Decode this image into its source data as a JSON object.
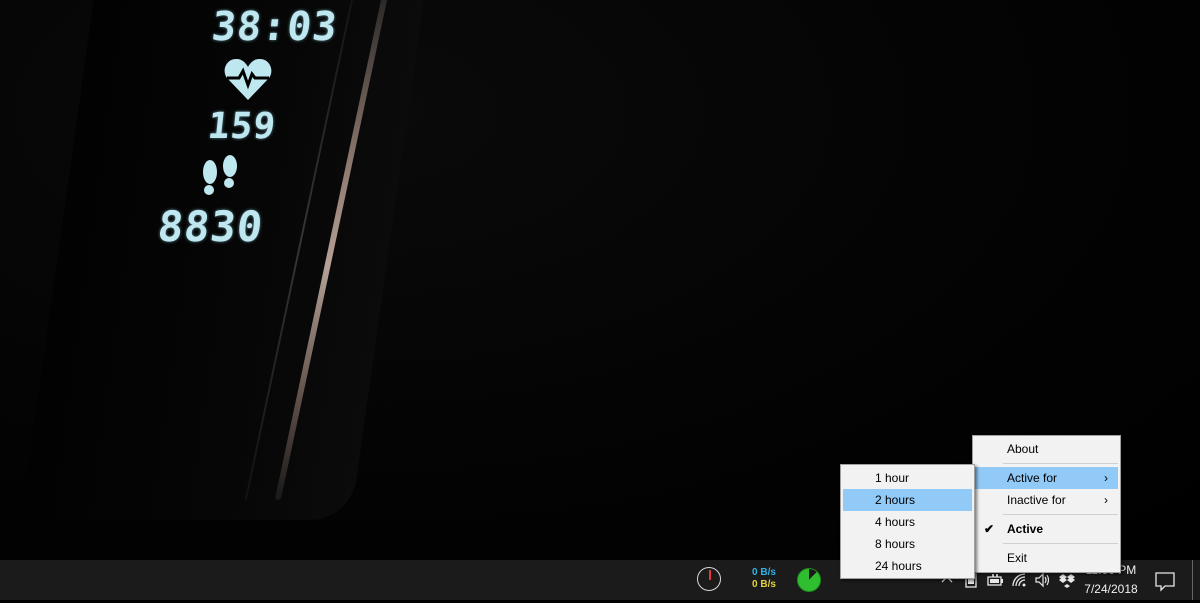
{
  "wallpaper": {
    "watch_time": "38:03",
    "watch_heart_rate": "159",
    "watch_steps": "8830"
  },
  "taskbar": {
    "net_upload": "0 B/s",
    "net_download": "0 B/s",
    "tray_icons": [
      "chevron-up-icon",
      "tablet-icon",
      "battery-icon",
      "wifi-icon",
      "volume-icon",
      "dropbox-icon"
    ],
    "clock_time": "11:00 PM",
    "clock_date": "7/24/2018",
    "colors": {
      "upload": "#2fb2e8",
      "download": "#e6d23a",
      "ram_meter": "#2fbe2f",
      "cpu_needle": "#e23a3a"
    }
  },
  "context_menu": {
    "items": [
      {
        "label": "About"
      },
      {
        "label": "Active for",
        "submenu": true,
        "highlighted": true
      },
      {
        "label": "Inactive for",
        "submenu": true
      },
      {
        "label": "Active",
        "checked": true,
        "bold": true
      },
      {
        "label": "Exit"
      }
    ],
    "highlight_color": "#91c9f7"
  },
  "submenu": {
    "items": [
      {
        "label": "1 hour"
      },
      {
        "label": "2 hours",
        "highlighted": true
      },
      {
        "label": "4 hours"
      },
      {
        "label": "8 hours"
      },
      {
        "label": "24 hours"
      }
    ]
  }
}
